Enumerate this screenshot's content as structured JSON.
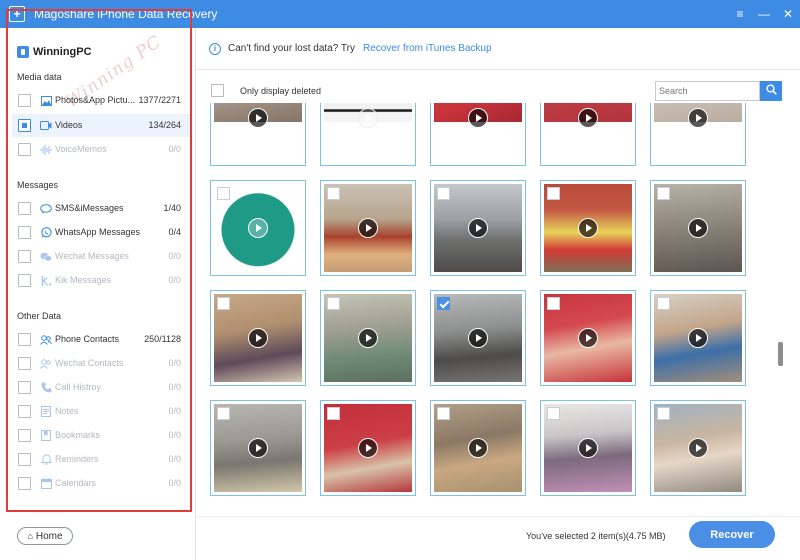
{
  "window": {
    "title": "Magoshare iPhone Data Recovery",
    "logo": "+",
    "menu_icon": "≡",
    "minimize_icon": "—",
    "close_icon": "✕"
  },
  "sidebar": {
    "device_name": "WinningPC",
    "watermark": "Winning PC",
    "sections": {
      "media": "Media data",
      "messages": "Messages",
      "other": "Other Data"
    },
    "items": [
      {
        "label": "Photos&App Pictu...",
        "count": "1377/2271",
        "icon": "photo-icon"
      },
      {
        "label": "Videos",
        "count": "134/264",
        "icon": "video-icon"
      },
      {
        "label": "VoiceMemos",
        "count": "0/0",
        "icon": "voice-memo-icon"
      },
      {
        "label": "SMS&iMessages",
        "count": "1/40",
        "icon": "sms-icon"
      },
      {
        "label": "WhatsApp Messages",
        "count": "0/4",
        "icon": "whatsapp-icon"
      },
      {
        "label": "Wechat Messages",
        "count": "0/0",
        "icon": "wechat-icon"
      },
      {
        "label": "Kik Messages",
        "count": "0/0",
        "icon": "kik-icon"
      },
      {
        "label": "Phone Contacts",
        "count": "250/1128",
        "icon": "contacts-icon"
      },
      {
        "label": "Wechat Contacts",
        "count": "0/0",
        "icon": "wechat-contacts-icon"
      },
      {
        "label": "Call Histroy",
        "count": "0/0",
        "icon": "call-history-icon"
      },
      {
        "label": "Notes",
        "count": "0/0",
        "icon": "notes-icon"
      },
      {
        "label": "Bookmarks",
        "count": "0/0",
        "icon": "bookmarks-icon"
      },
      {
        "label": "Reminders",
        "count": "0/0",
        "icon": "reminders-icon"
      },
      {
        "label": "Calendars",
        "count": "0/0",
        "icon": "calendars-icon"
      }
    ],
    "home_icon": "⌂",
    "home_label": "Home"
  },
  "info": {
    "icon": "i",
    "message": "Can't find your lost data? Try",
    "link": "Recover from iTunes Backup"
  },
  "filter": {
    "only_deleted_label": "Only display deleted"
  },
  "search": {
    "placeholder": "Search"
  },
  "footer": {
    "status": "You've selected 2 item(s)(4.75 MB)",
    "recover_label": "Recover"
  },
  "colors": {
    "accent": "#3d8be3",
    "highlight_frame": "#e03c3c",
    "tile_border": "#7ec1e4"
  }
}
